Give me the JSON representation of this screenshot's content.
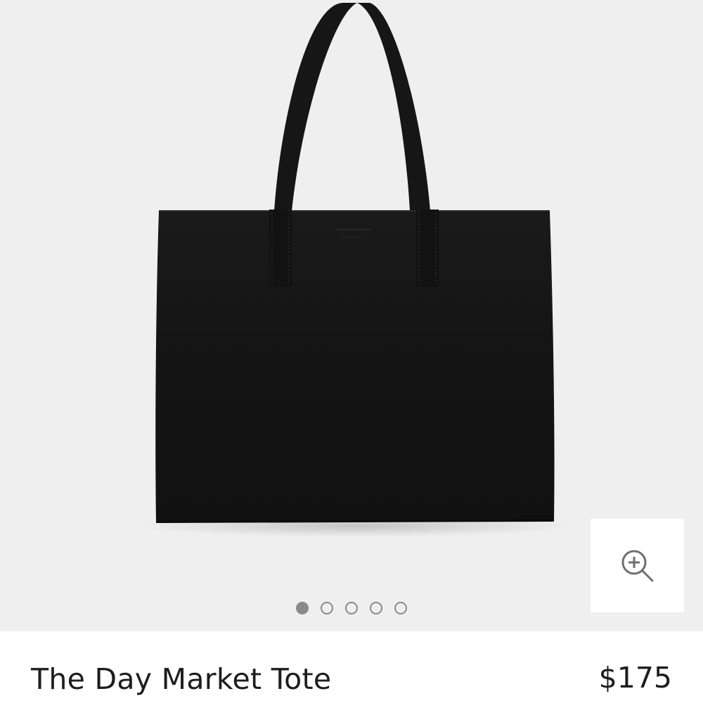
{
  "gallery": {
    "image_alt": "black leather tote bag",
    "slide_count": 5,
    "active_slide": 0
  },
  "zoom": {
    "icon": "zoom-in-icon"
  },
  "product": {
    "name": "The Day Market Tote",
    "price": "$175"
  },
  "colors": {
    "background": "#efefef",
    "bag": "#161616",
    "text": "#1d1d1d",
    "pager": "#8a8a8a"
  }
}
